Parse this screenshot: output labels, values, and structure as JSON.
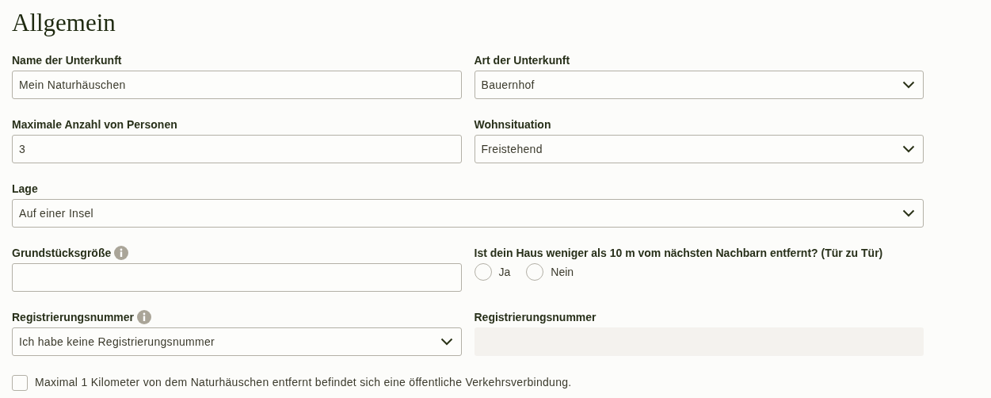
{
  "title": "Allgemein",
  "rows": [
    {
      "fields": [
        {
          "kind": "text",
          "label": "Name der Unterkunft",
          "info": false,
          "value": "Mein Naturhäuschen"
        },
        {
          "kind": "select",
          "label": "Art der Unterkunft",
          "info": false,
          "value": "Bauernhof"
        }
      ]
    },
    {
      "fields": [
        {
          "kind": "text",
          "label": "Maximale Anzahl von Personen",
          "info": false,
          "value": "3"
        },
        {
          "kind": "select",
          "label": "Wohnsituation",
          "info": false,
          "value": "Freistehend"
        }
      ]
    },
    {
      "fields": [
        {
          "kind": "select",
          "label": "Lage",
          "info": false,
          "value": "Auf einer Insel"
        }
      ]
    },
    {
      "fields": [
        {
          "kind": "text",
          "label": "Grundstücksgröße",
          "info": true
        },
        {
          "kind": "radio",
          "label": "Ist dein Haus weniger als 10 m vom nächsten Nachbarn entfernt? (Tür zu Tür)",
          "info": false,
          "options": [
            {
              "label": "Ja",
              "selected": false
            },
            {
              "label": "Nein",
              "selected": false
            }
          ]
        }
      ]
    },
    {
      "fields": [
        {
          "kind": "select",
          "label": "Registrierungsnummer",
          "info": true,
          "value": "Ich habe keine Registrierungsnummer"
        },
        {
          "kind": "readonly",
          "label": "Registrierungsnummer",
          "info": false
        }
      ]
    }
  ],
  "checkbox": {
    "label": "Maximal 1 Kilometer von dem Naturhäuschen entfernt befindet sich eine öffentliche Verkehrsverbindung.",
    "checked": false
  }
}
